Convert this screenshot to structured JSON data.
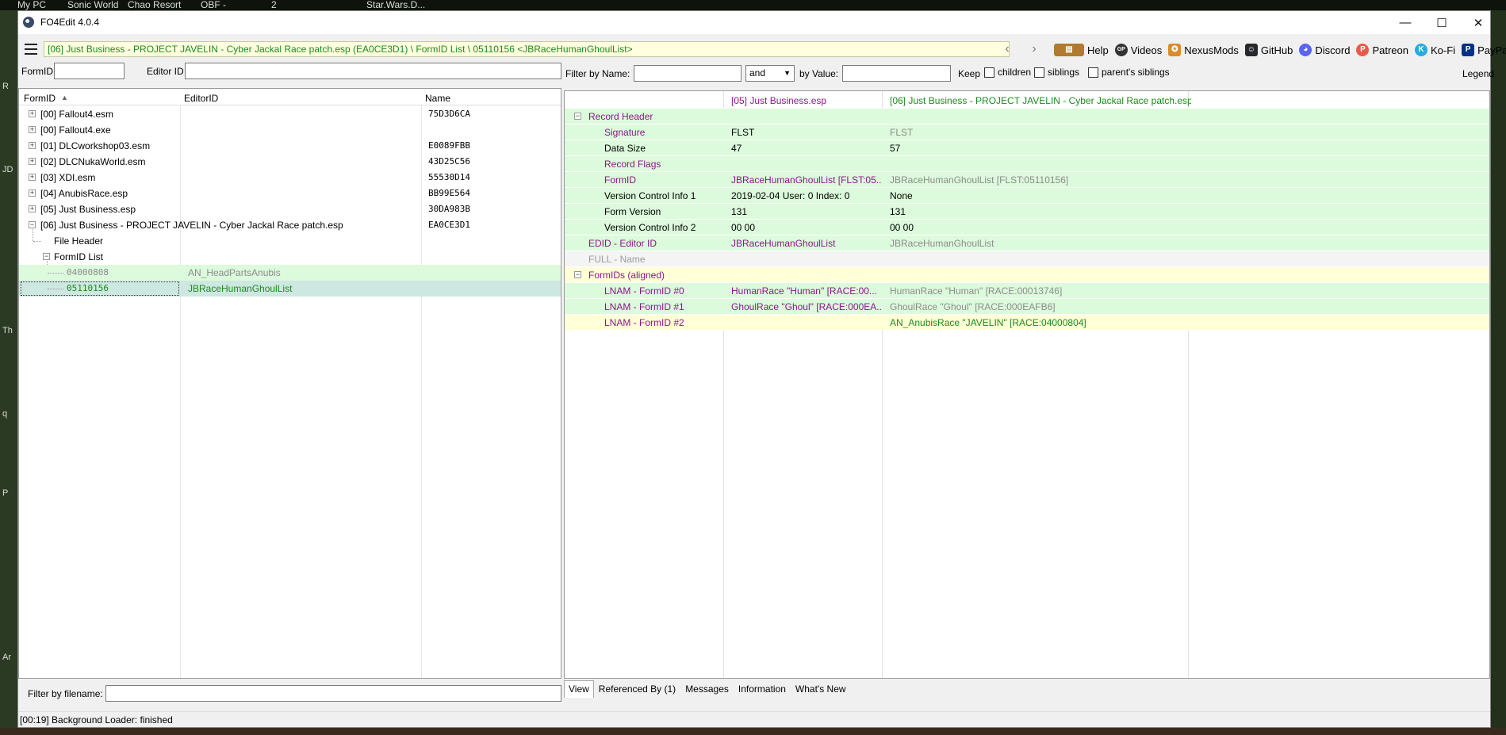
{
  "desktop": {
    "top_items": [
      "My PC",
      "Sonic World",
      "Chao Resort",
      "OBF -",
      "2",
      "Star.Wars.D..."
    ],
    "left_letters": [
      "R",
      "JD",
      "Th",
      "q",
      "P",
      "Ar"
    ]
  },
  "window": {
    "title": "FO4Edit 4.0.4",
    "minimize": "—",
    "maximize": "☐",
    "close": "✕"
  },
  "toolbar": {
    "path": "[06] Just Business - PROJECT JAVELIN - Cyber Jackal Race patch.esp (EA0CE3D1) \\ FormID List \\ 05110156 <JBRaceHumanGhoulList>",
    "back": "‹",
    "forward": "›",
    "links": [
      {
        "label": "Help",
        "icon": "book-icon",
        "color": "#b07a30",
        "glyph": "▤"
      },
      {
        "label": "Videos",
        "icon": "gp-icon",
        "color": "#333333",
        "glyph": "GP"
      },
      {
        "label": "NexusMods",
        "icon": "nexusmods-icon",
        "color": "#d98c2a",
        "glyph": "✪"
      },
      {
        "label": "GitHub",
        "icon": "github-icon",
        "color": "#24292e",
        "glyph": "☺"
      },
      {
        "label": "Discord",
        "icon": "discord-icon",
        "color": "#5865f2",
        "glyph": "◕"
      },
      {
        "label": "Patreon",
        "icon": "patreon-icon",
        "color": "#e85b46",
        "glyph": "P"
      },
      {
        "label": "Ko-Fi",
        "icon": "kofi-icon",
        "color": "#29abe0",
        "glyph": "K"
      },
      {
        "label": "PayPal",
        "icon": "paypal-icon",
        "color": "#003087",
        "glyph": "P"
      }
    ]
  },
  "left": {
    "formid_label": "FormID",
    "editorid_label": "Editor ID",
    "formid_value": "",
    "editorid_value": "",
    "columns": [
      "FormID",
      "EditorID",
      "Name"
    ],
    "sort_arrow": "▲",
    "files": [
      {
        "label": "[00] Fallout4.esm",
        "crc": "75D3D6CA",
        "expander": "+"
      },
      {
        "label": "[00] Fallout4.exe",
        "crc": "",
        "expander": "+"
      },
      {
        "label": "[01] DLCworkshop03.esm",
        "crc": "E0089FBB",
        "expander": "+"
      },
      {
        "label": "[02] DLCNukaWorld.esm",
        "crc": "43D25C56",
        "expander": "+"
      },
      {
        "label": "[03] XDI.esm",
        "crc": "55530D14",
        "expander": "+"
      },
      {
        "label": "[04] AnubisRace.esp",
        "crc": "BB99E564",
        "expander": "+"
      },
      {
        "label": "[05] Just Business.esp",
        "crc": "30DA983B",
        "expander": "+"
      },
      {
        "label": "[06] Just Business - PROJECT JAVELIN - Cyber Jackal Race patch.esp",
        "crc": "EA0CE3D1",
        "expander": "−"
      }
    ],
    "file_header": "File Header",
    "formid_list": "FormID List",
    "records": [
      {
        "formid": "04000808",
        "editorid": "AN_HeadPartsAnubis"
      },
      {
        "formid": "05110156",
        "editorid": "JBRaceHumanGhoulList"
      }
    ],
    "filter_filename_label": "Filter by filename:",
    "filter_filename_value": ""
  },
  "right": {
    "filter_name_label": "Filter by Name:",
    "filter_name_value": "",
    "op_value": "and",
    "by_value_label": "by Value:",
    "by_value_value": "",
    "keep_label": "Keep",
    "children_label": "children",
    "siblings_label": "siblings",
    "parents_siblings_label": "parent's siblings",
    "legend_label": "Legend",
    "col_headers": [
      "[05] Just Business.esp",
      "[06] Just Business - PROJECT JAVELIN - Cyber Jackal Race patch.esp"
    ],
    "rows": [
      {
        "key": "Record Header",
        "v1": "",
        "v2": ""
      },
      {
        "key": "Signature",
        "v1": "FLST",
        "v2": "FLST"
      },
      {
        "key": "Data Size",
        "v1": "47",
        "v2": "57"
      },
      {
        "key": "Record Flags",
        "v1": "",
        "v2": ""
      },
      {
        "key": "FormID",
        "v1": "JBRaceHumanGhoulList [FLST:05...",
        "v2": "JBRaceHumanGhoulList [FLST:05110156]"
      },
      {
        "key": "Version Control Info 1",
        "v1": "2019-02-04 User: 0 Index: 0",
        "v2": "None"
      },
      {
        "key": "Form Version",
        "v1": "131",
        "v2": "131"
      },
      {
        "key": "Version Control Info 2",
        "v1": "00 00",
        "v2": "00 00"
      },
      {
        "key": "EDID - Editor ID",
        "v1": "JBRaceHumanGhoulList",
        "v2": "JBRaceHumanGhoulList"
      },
      {
        "key": "FULL - Name",
        "v1": "",
        "v2": ""
      },
      {
        "key": "FormIDs (aligned)",
        "v1": "",
        "v2": ""
      },
      {
        "key": "LNAM - FormID #0",
        "v1": "HumanRace \"Human\" [RACE:00...",
        "v2": "HumanRace \"Human\" [RACE:00013746]"
      },
      {
        "key": "LNAM - FormID #1",
        "v1": "GhoulRace \"Ghoul\" [RACE:000EA...",
        "v2": "GhoulRace \"Ghoul\" [RACE:000EAFB6]"
      },
      {
        "key": "LNAM - FormID #2",
        "v1": "",
        "v2": "AN_AnubisRace \"JAVELIN\" [RACE:04000804]"
      }
    ],
    "tabs": [
      "View",
      "Referenced By (1)",
      "Messages",
      "Information",
      "What's New"
    ]
  },
  "status": {
    "text": "[00:19] Background Loader: finished"
  },
  "colors": {
    "green_row": "#dcfadc",
    "yellow_row": "#ffffd8",
    "purple_text": "#8a178a",
    "green_text": "#1d8a1d"
  }
}
